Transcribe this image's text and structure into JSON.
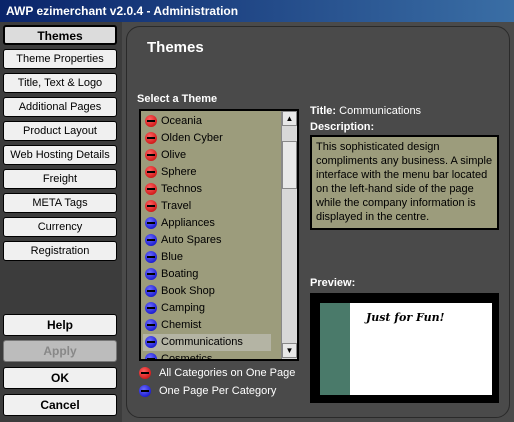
{
  "window": {
    "title": "AWP ezimerchant v2.0.4 - Administration"
  },
  "nav": [
    "Themes",
    "Theme Properties",
    "Title, Text & Logo",
    "Additional Pages",
    "Product Layout",
    "Web Hosting Details",
    "Freight",
    "META Tags",
    "Currency",
    "Registration"
  ],
  "actions": {
    "help": "Help",
    "apply": "Apply",
    "ok": "OK",
    "cancel": "Cancel"
  },
  "panel": {
    "title": "Themes",
    "select_label": "Select a Theme",
    "title_label": "Title:",
    "title_value": "Communications",
    "description_label": "Description:",
    "description": "This sophisticated design compliments any business. A simple interface with the menu bar located on the left-hand side of the page while the company information is displayed in the centre.",
    "preview_label": "Preview:",
    "preview_logo": "Just for Fun!"
  },
  "themes": [
    {
      "name": "Oceania",
      "icon": "red"
    },
    {
      "name": "Olden Cyber",
      "icon": "red"
    },
    {
      "name": "Olive",
      "icon": "red"
    },
    {
      "name": "Sphere",
      "icon": "red"
    },
    {
      "name": "Technos",
      "icon": "red"
    },
    {
      "name": "Travel",
      "icon": "red"
    },
    {
      "name": "Appliances",
      "icon": "blue"
    },
    {
      "name": "Auto Spares",
      "icon": "blue"
    },
    {
      "name": "Blue",
      "icon": "blue"
    },
    {
      "name": "Boating",
      "icon": "blue"
    },
    {
      "name": "Book Shop",
      "icon": "blue"
    },
    {
      "name": "Camping",
      "icon": "blue"
    },
    {
      "name": "Chemist",
      "icon": "blue"
    },
    {
      "name": "Communications",
      "icon": "blue",
      "selected": true
    },
    {
      "name": "Cosmetics",
      "icon": "blue"
    }
  ],
  "legend": {
    "all": "All Categories on One Page",
    "per": "One Page Per Category"
  }
}
